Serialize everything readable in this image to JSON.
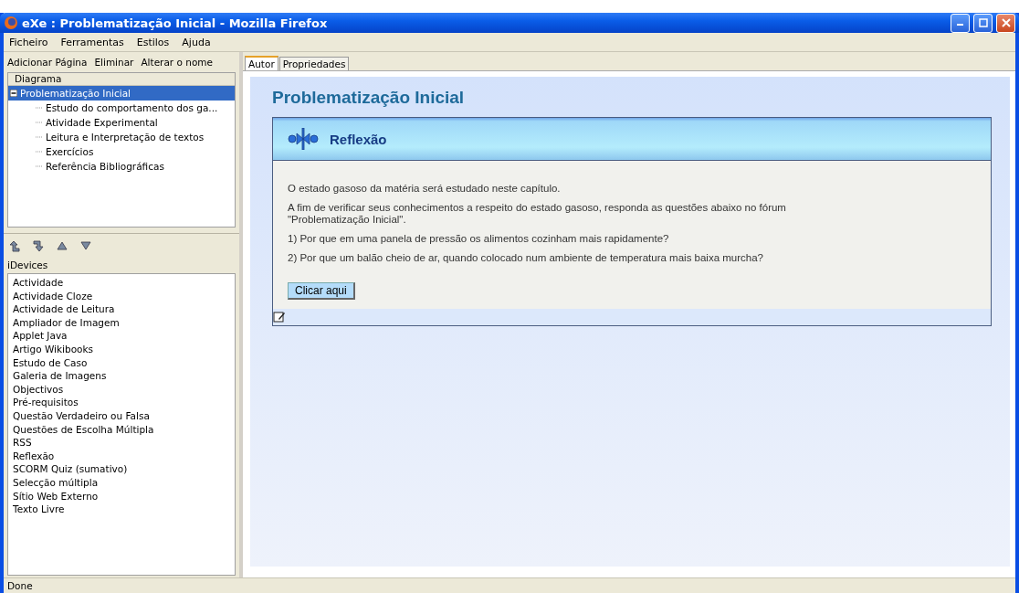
{
  "window": {
    "title": "eXe : Problematização Inicial - Mozilla Firefox"
  },
  "menu": [
    "Ficheiro",
    "Ferramentas",
    "Estilos",
    "Ajuda"
  ],
  "toolbar": [
    "Adicionar Página",
    "Eliminar",
    "Alterar o nome"
  ],
  "tree": {
    "heading": "Diagrama",
    "items": [
      {
        "label": "Problematização Inicial",
        "selected": true,
        "expanded": true,
        "children": [
          {
            "label": "Estudo do comportamento dos ga...",
            "selected": false
          },
          {
            "label": "Atividade Experimental",
            "selected": false
          },
          {
            "label": "Leitura e Interpretação de textos",
            "selected": false
          },
          {
            "label": "Exercícios",
            "selected": false
          },
          {
            "label": "Referência Bibliográficas",
            "selected": false
          }
        ]
      }
    ]
  },
  "idevices": {
    "heading": "iDevices",
    "items": [
      "Actividade",
      "Actividade Cloze",
      "Actividade de Leitura",
      "Ampliador de Imagem",
      "Applet Java",
      "Artigo Wikibooks",
      "Estudo de Caso",
      "Galeria de Imagens",
      "Objectivos",
      "Pré-requisitos",
      "Questão Verdadeiro ou Falsa",
      "Questões de Escolha Múltipla",
      "RSS",
      "Reflexão",
      "SCORM Quiz (sumativo)",
      "Selecção múltipla",
      "Sítio Web Externo",
      "Texto Livre"
    ]
  },
  "tabs": [
    {
      "label": "Autor",
      "selected": true
    },
    {
      "label": "Propriedades",
      "selected": false
    }
  ],
  "page": {
    "title": "Problematização Inicial",
    "idevice": {
      "title": "Reflexão",
      "paragraphs": [
        "O estado gasoso da matéria será estudado neste capítulo.",
        "A fim de verificar seus conhecimentos a respeito do estado gasoso, responda as questões abaixo no fórum \"Problematização Inicial\".",
        "1) Por que em uma panela de pressão os alimentos cozinham mais rapidamente?",
        "2) Por que um balão cheio de ar, quando colocado num ambiente de temperatura mais baixa murcha?"
      ],
      "button": "Clicar aqui"
    }
  },
  "status_bar": "Done"
}
